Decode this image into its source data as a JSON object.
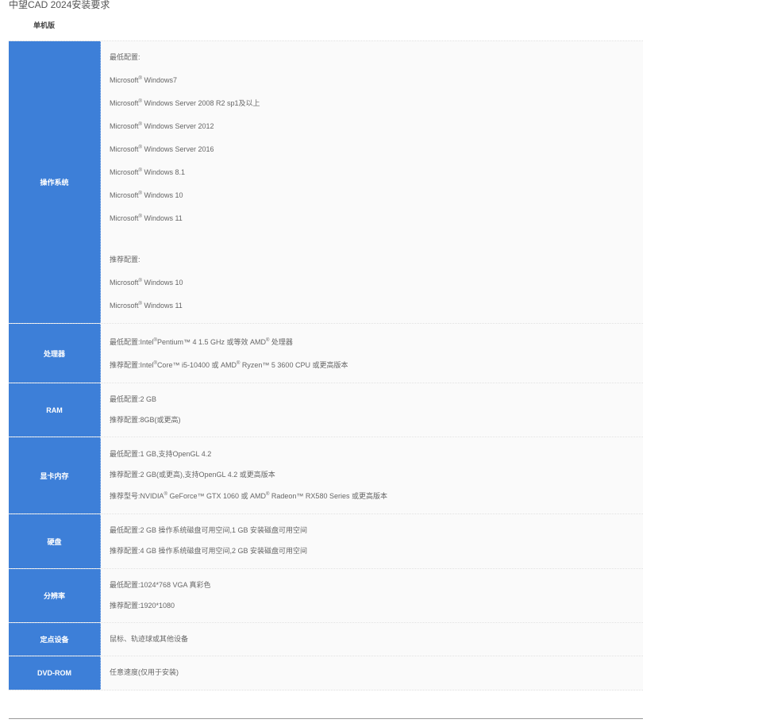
{
  "page": {
    "title": "中望CAD 2024安装要求",
    "edition": "单机版"
  },
  "os": {
    "label": "操作系统",
    "min_label": "最低配置:",
    "rec_label": "推荐配置:",
    "brand": "Microsoft",
    "reg_mark": "®",
    "min_items": [
      "Windows7",
      "Windows Server 2008 R2 sp1及以上",
      "Windows Server 2012",
      "Windows Server 2016",
      "Windows 8.1",
      "Windows 10",
      "Windows 11"
    ],
    "rec_items": [
      "Windows 10",
      "Windows 11"
    ]
  },
  "cpu": {
    "label": "处理器",
    "min_prefix": "最低配置:Intel",
    "min_suffix": "Pentium™ 4 1.5 GHz 或等效 AMD",
    "min_tail": " 处理器",
    "rec_prefix": "推荐配置:Intel",
    "rec_mid": "Core™ i5-10400 或 AMD",
    "rec_tail": " Ryzen™ 5 3600 CPU 或更高版本",
    "reg_mark": "®"
  },
  "ram": {
    "label": "RAM",
    "lines": [
      "最低配置:2 GB",
      "推荐配置:8GB(或更高)"
    ]
  },
  "gpu": {
    "label": "显卡内存",
    "lines": [
      "最低配置:1 GB,支持OpenGL 4.2",
      "推荐配置:2 GB(或更高),支持OpenGL 4.2 或更高版本"
    ],
    "model_prefix": "推荐型号:NVIDIA",
    "model_mid": " GeForce™ GTX 1060 或 AMD",
    "model_tail": " Radeon™ RX580 Series 或更高版本",
    "reg_mark": "®"
  },
  "disk": {
    "label": "硬盘",
    "lines": [
      "最低配置:2 GB 操作系统磁盘可用空间,1 GB 安装磁盘可用空间",
      "推荐配置:4 GB 操作系统磁盘可用空间,2 GB 安装磁盘可用空间"
    ]
  },
  "resolution": {
    "label": "分辨率",
    "lines": [
      "最低配置:1024*768 VGA 真彩色",
      "推荐配置:1920*1080"
    ]
  },
  "pointing": {
    "label": "定点设备",
    "lines": [
      "鼠标、轨迹球或其他设备"
    ]
  },
  "dvd": {
    "label": "DVD-ROM",
    "lines": [
      "任意速度(仅用于安装)"
    ]
  }
}
